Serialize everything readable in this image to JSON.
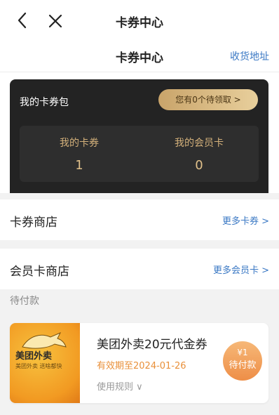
{
  "topbar": {
    "title": "卡券中心"
  },
  "header": {
    "title": "卡券中心",
    "address_link": "收货地址"
  },
  "wallet": {
    "title": "我的卡券包",
    "pending_pill": "您有0个待领取 >",
    "stats": [
      {
        "label": "我的卡券",
        "value": "1"
      },
      {
        "label": "我的会员卡",
        "value": "0"
      }
    ]
  },
  "coupon_store": {
    "title": "卡券商店",
    "link": "更多卡券 >"
  },
  "member_store": {
    "title": "会员卡商店",
    "link": "更多会员卡 >"
  },
  "pending": {
    "label": "待付款",
    "item": {
      "logo": "美团外卖",
      "logo_sub": "美团外卖 送啥都快",
      "title": "美团外卖20元代金券",
      "expiry": "有效期至2024-01-26",
      "rules": "使用规则 ∨",
      "price": "¥1",
      "action": "待付款"
    }
  },
  "colors": {
    "accent": "#3a78c4",
    "wallet_bg": "#232323",
    "gold": "#d3b07a",
    "orange": "#ee8e47"
  }
}
